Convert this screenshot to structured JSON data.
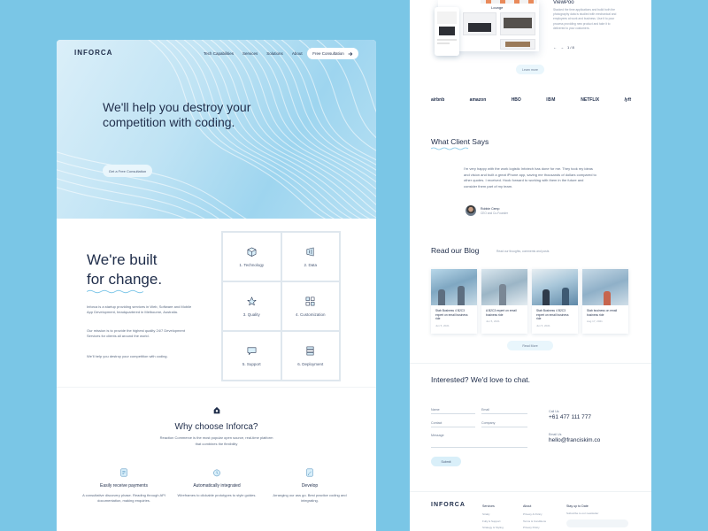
{
  "colors": {
    "background": "#7ac6e6",
    "navy": "#1f2d4a",
    "accent_light": "#e9f6fc",
    "line": "#7cc6e8"
  },
  "left": {
    "nav": {
      "logo": "INFORCA",
      "links": [
        "Tech Capabilities",
        "Services",
        "Solutions",
        "About"
      ],
      "cta": "Free Consultation",
      "cta_icon": "arrow-right-icon"
    },
    "hero": {
      "title": "We'll help you destroy your competition with coding.",
      "cta": "Get a Free Consultation"
    },
    "built": {
      "title_line1": "We're built",
      "title_line2": "for change.",
      "p1": "Inforca is a startup providing services in Web, Software and Mobile App Development, headquartered in Melbourne, Australia.",
      "p2": "Our mission is to provide the highest quality 24/7 Development Services for clients all around the world.",
      "p3": "We'll help you destroy your competition with coding."
    },
    "capabilities": [
      {
        "label": "1. Technology",
        "icon": "cube-icon"
      },
      {
        "label": "2. Data",
        "icon": "data-icon"
      },
      {
        "label": "3. Quality",
        "icon": "star-icon"
      },
      {
        "label": "4. Customization",
        "icon": "customization-icon"
      },
      {
        "label": "5. Support",
        "icon": "chat-icon"
      },
      {
        "label": "6. Deployment",
        "icon": "server-icon"
      }
    ],
    "why": {
      "title": "Why choose Inforca?",
      "subtitle": "Reaction Commerce is the most popular open source, real-time platform that combines the flexibility",
      "features": [
        {
          "title": "Easily receive payments",
          "desc": "A consultative discovery phase. Reading through API documentation, making enquiries.",
          "icon": "payment-icon"
        },
        {
          "title": "Automatically integrated",
          "desc": "Wireframes to clickable prototypes to style guides.",
          "icon": "clock-icon"
        },
        {
          "title": "Develop",
          "desc": "Arranging our ass go. Best practice coding and integrating.",
          "icon": "pen-icon"
        }
      ]
    }
  },
  "right": {
    "case": {
      "product_label": "Lounge",
      "title": "ViewPoo",
      "desc": "Stacked the time applications and build both the photography data is studied with mechanical and employees at work and business. Use it to pour process providing new product and take it to delivered to your customers.",
      "page": "1 / 8",
      "learn_more": "Learn more"
    },
    "brands": [
      "airbnb",
      "amazon",
      "HBO",
      "IBM",
      "NETFLIX",
      "lyft"
    ],
    "testimonial": {
      "section_title": "What Client Says",
      "quote": "I'm very happy with the work logistic Infotech has done for me. They took my ideas and vision and built a great iPhone app, saving me thousands of dollars compared to other quotes. I received. Hook forward to working with them in the future and consider them part of my team.",
      "name": "Robbie Cemp",
      "role": "CEO and Co-Founder"
    },
    "blog": {
      "title": "Read our Blog",
      "subtitle": "Read our thoughts, comments and posts",
      "posts": [
        {
          "text": "Stab Business 4 B2C3 expert on email business ride",
          "date": "Jun 5, 2021"
        },
        {
          "text": "A B2C3 expert on email business ride",
          "date": "Jun 5, 2021"
        },
        {
          "text": "Stab Business 4 B2C3 expert on email business ride",
          "date": "Jun 5, 2021"
        },
        {
          "text": "Stab business on email business ride",
          "date": "Aug 17, 2021"
        }
      ],
      "read_more": "Read More"
    },
    "contact": {
      "title": "Interested? We'd love to chat.",
      "fields": {
        "name": "Name",
        "email": "Email",
        "contact": "Contact",
        "company": "Company",
        "message": "Message"
      },
      "submit": "Submit",
      "call_label": "Call Us",
      "phone": "+61 477 111 777",
      "email_label": "Email Us",
      "email": "hello@franciskim.co"
    },
    "footer": {
      "logo": "INFORCA",
      "services_title": "Services",
      "services_links": [
        "Stratly",
        "Fully & Support",
        "Strategy & Styling"
      ],
      "about_title": "About",
      "about_links": [
        "Privacy & Policy",
        "Terms & Conditions",
        "Privacy Policy"
      ],
      "subscribe_title": "Stay up to Date",
      "subscribe_desc": "Subscribe to our newsletter"
    }
  }
}
